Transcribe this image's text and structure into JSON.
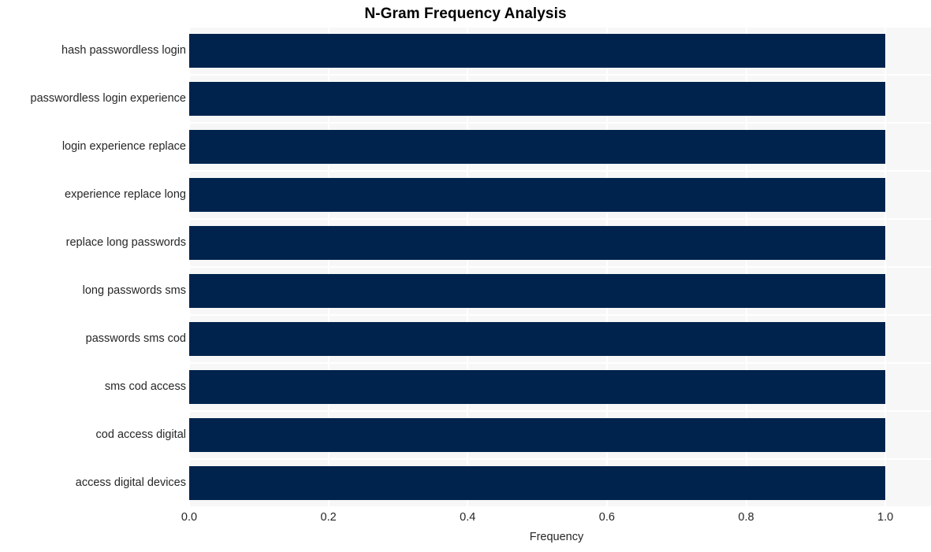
{
  "chart_data": {
    "type": "bar",
    "orientation": "horizontal",
    "title": "N-Gram Frequency Analysis",
    "xlabel": "Frequency",
    "ylabel": "",
    "xlim": [
      0.0,
      1.0655
    ],
    "xticks": [
      "0.0",
      "0.2",
      "0.4",
      "0.6",
      "0.8",
      "1.0"
    ],
    "xtick_values": [
      0.0,
      0.2,
      0.4,
      0.6,
      0.8,
      1.0
    ],
    "grid": true,
    "legend": null,
    "categories": [
      "hash passwordless login",
      "passwordless login experience",
      "login experience replace",
      "experience replace long",
      "replace long passwords",
      "long passwords sms",
      "passwords sms cod",
      "sms cod access",
      "cod access digital",
      "access digital devices"
    ],
    "values": [
      1.0,
      1.0,
      1.0,
      1.0,
      1.0,
      1.0,
      1.0,
      1.0,
      1.0,
      1.0
    ],
    "bar_color": "#00234d",
    "plot_background": "#f7f7f7",
    "grid_color": "#ffffff",
    "text_color": "#262626"
  }
}
